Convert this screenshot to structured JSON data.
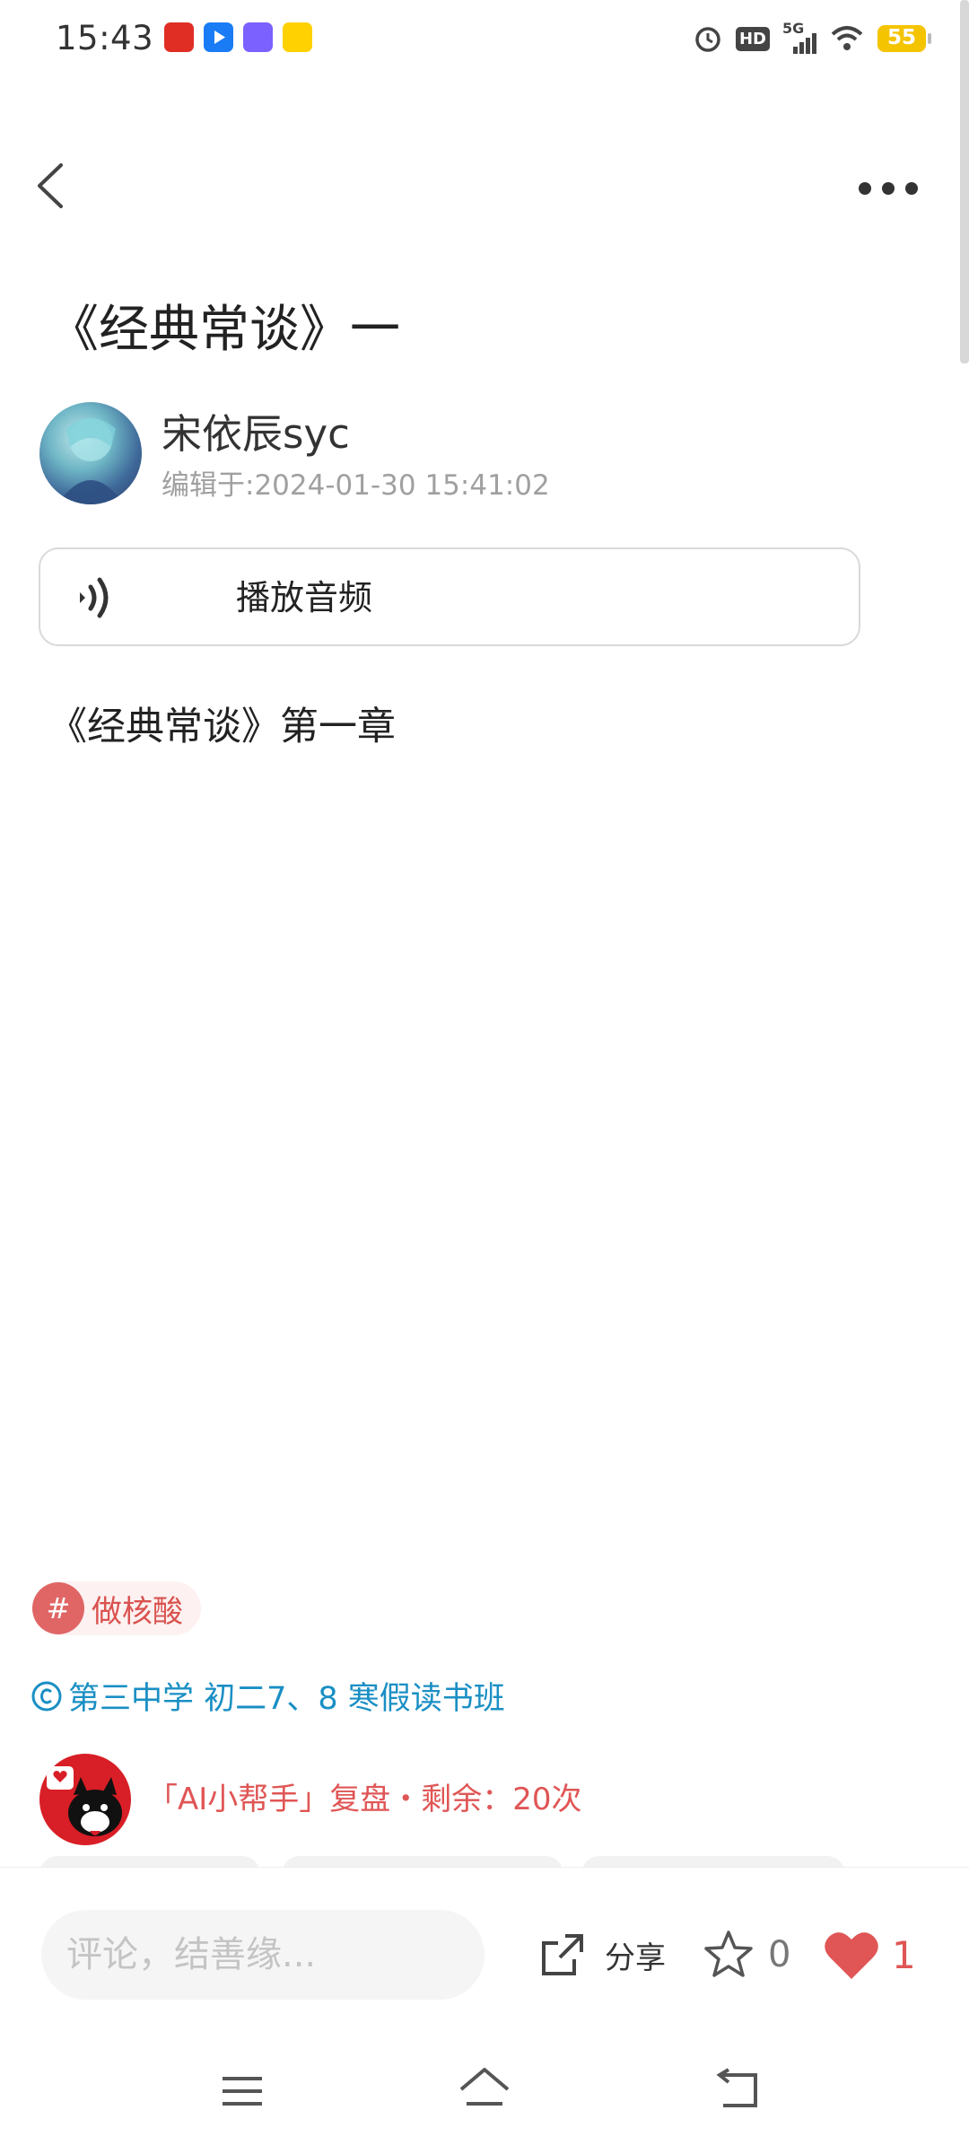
{
  "status_bar": {
    "time": "15:43",
    "battery": "55",
    "network": "5G",
    "hd": "HD",
    "app_icons": [
      "拼多多",
      "腾讯视频",
      "百度网盘",
      "美团"
    ]
  },
  "header": {
    "back_icon": "back-chevron-icon",
    "more_icon": "more-dots-icon"
  },
  "post": {
    "title": "《经典常谈》一",
    "author": "宋依辰syc",
    "edit_time": "编辑于:2024-01-30 15:41:02",
    "audio_label": "播放音频",
    "body": "《经典常谈》第一章"
  },
  "tag": {
    "hash": "#",
    "label": "做核酸"
  },
  "class_link": "第三中学 初二7、8 寒假读书班",
  "ai_helper": "「AI小帮手」复盘・剩余：20次",
  "bottom_bar": {
    "comment_placeholder": "评论，结善缘...",
    "share_label": "分享",
    "star_count": "0",
    "like_count": "1"
  },
  "colors": {
    "accent_red": "#e05555",
    "link_blue": "#1a8fc4",
    "battery_yellow": "#f5c400"
  }
}
